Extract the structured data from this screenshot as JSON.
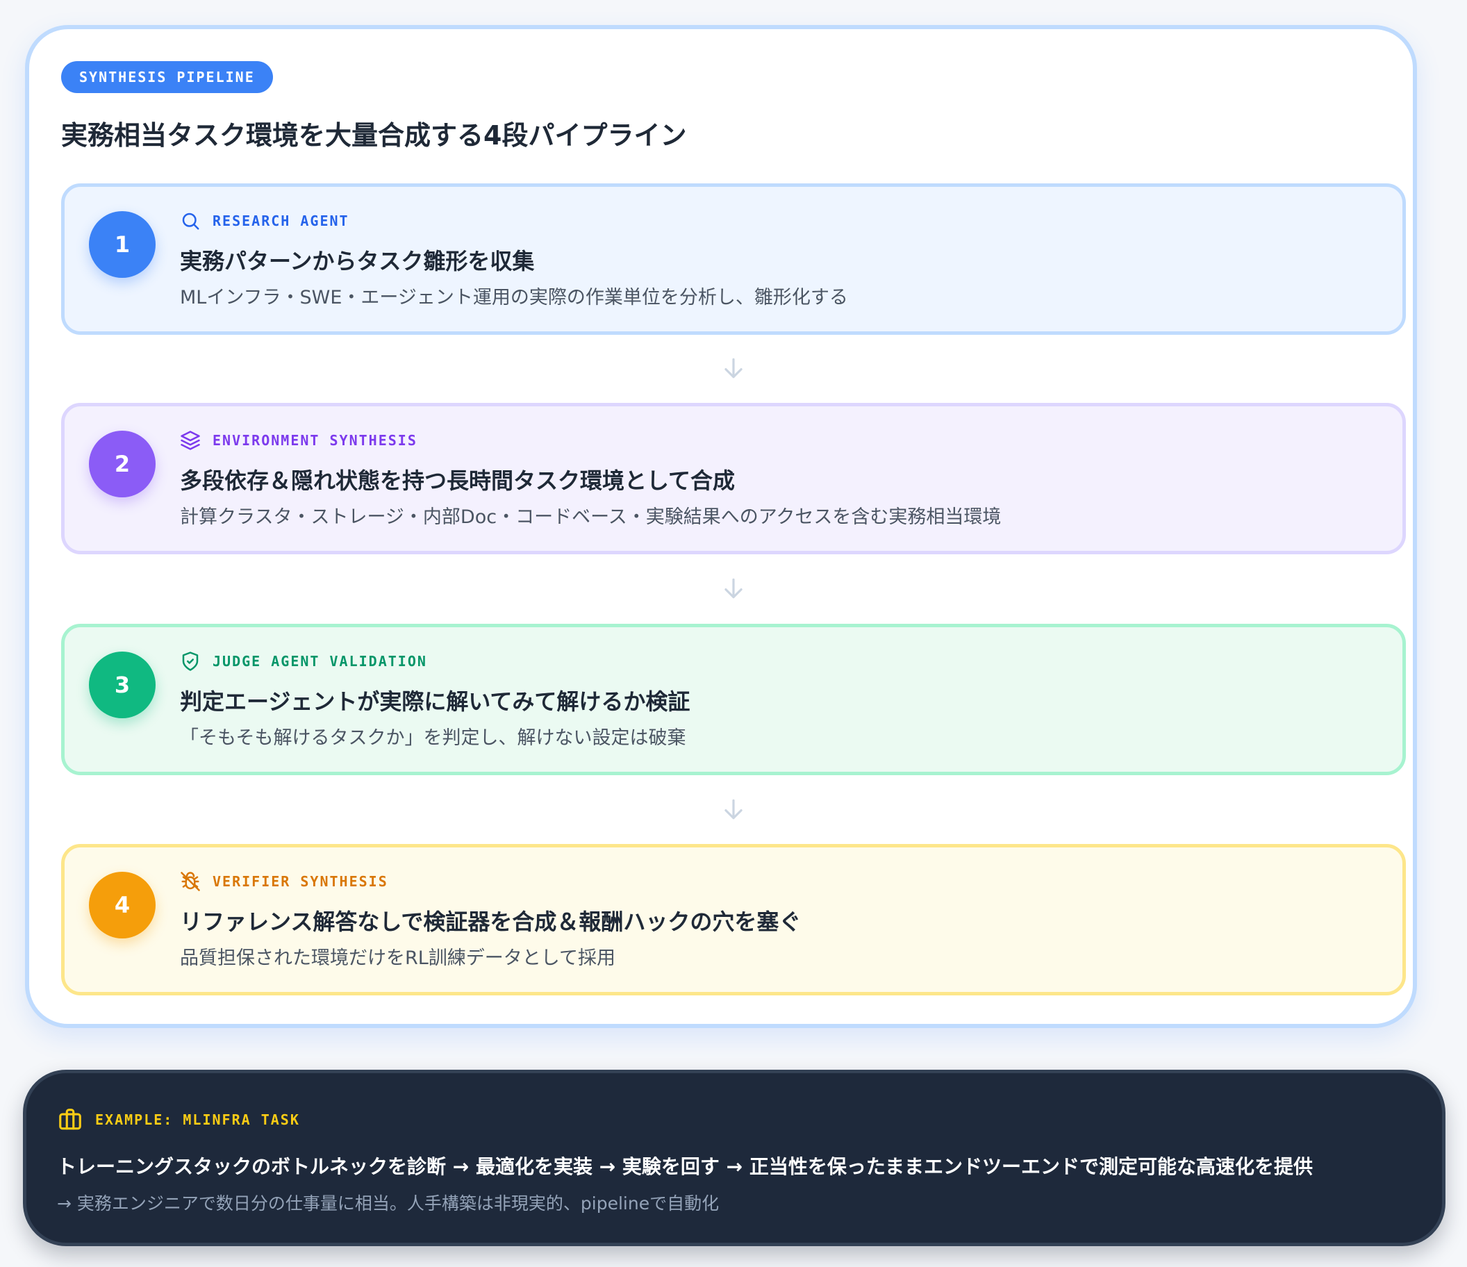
{
  "header": {
    "tag": "SYNTHESIS PIPELINE",
    "title": "実務相当タスク環境を大量合成する4段パイプライン"
  },
  "steps": [
    {
      "number": "1",
      "icon": "search-icon",
      "label": "RESEARCH AGENT",
      "title": "実務パターンからタスク雛形を収集",
      "description": "MLインフラ・SWE・エージェント運用の実際の作業単位を分析し、雛形化する",
      "accent": "#3b82f6"
    },
    {
      "number": "2",
      "icon": "layers-icon",
      "label": "ENVIRONMENT SYNTHESIS",
      "title": "多段依存＆隠れ状態を持つ長時間タスク環境として合成",
      "description": "計算クラスタ・ストレージ・内部Doc・コードベース・実験結果へのアクセスを含む実務相当環境",
      "accent": "#8b5cf6"
    },
    {
      "number": "3",
      "icon": "shield-check-icon",
      "label": "JUDGE AGENT VALIDATION",
      "title": "判定エージェントが実際に解いてみて解けるか検証",
      "description": "「そもそも解けるタスクか」を判定し、解けない設定は破棄",
      "accent": "#10b981"
    },
    {
      "number": "4",
      "icon": "bug-off-icon",
      "label": "VERIFIER SYNTHESIS",
      "title": "リファレンス解答なしで検証器を合成＆報酬ハックの穴を塞ぐ",
      "description": "品質担保された環境だけをRL訓練データとして採用",
      "accent": "#f59e0b"
    }
  ],
  "example": {
    "icon": "briefcase-icon",
    "label": "EXAMPLE: MLINFRA TASK",
    "text": "トレーニングスタックのボトルネックを診断 → 最適化を実装 → 実験を回す → 正当性を保ったままエンドツーエンドで測定可能な高速化を提供",
    "note": "→ 実務エンジニアで数日分の仕事量に相当。人手構築は非現実的、pipelineで自動化"
  }
}
